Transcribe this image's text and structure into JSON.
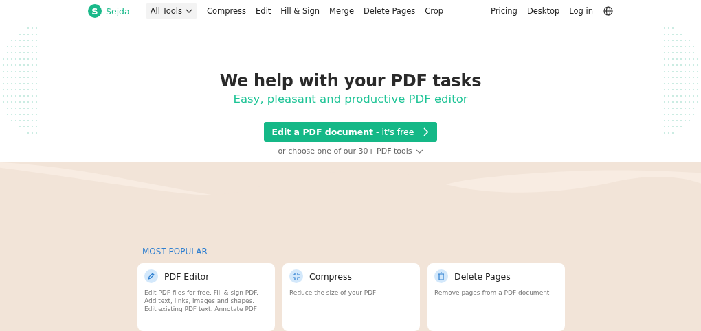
{
  "brand": {
    "name": "Sejda",
    "letter": "S"
  },
  "nav": {
    "dropdown": "All Tools",
    "links": [
      "Compress",
      "Edit",
      "Fill & Sign",
      "Merge",
      "Delete Pages",
      "Crop"
    ],
    "right_links": [
      "Pricing",
      "Desktop",
      "Log in"
    ]
  },
  "hero": {
    "title": "We help with your PDF tasks",
    "subtitle": "Easy, pleasant and productive PDF editor",
    "cta": "**Edit a PDF document** - it's free",
    "more": "or choose one of our 30+ PDF tools"
  },
  "popular": {
    "heading": "MOST POPULAR",
    "cards": [
      {
        "kind": "pencil",
        "title": "PDF Editor",
        "description": "Edit PDF files for free. Fill & sign PDF. Add text, links, images and shapes. Edit existing PDF text. Annotate PDF"
      },
      {
        "kind": "compress",
        "title": "Compress",
        "description": "Reduce the size of your PDF"
      },
      {
        "kind": "trash",
        "title": "Delete Pages",
        "description": "Remove pages from a PDF document"
      }
    ]
  }
}
